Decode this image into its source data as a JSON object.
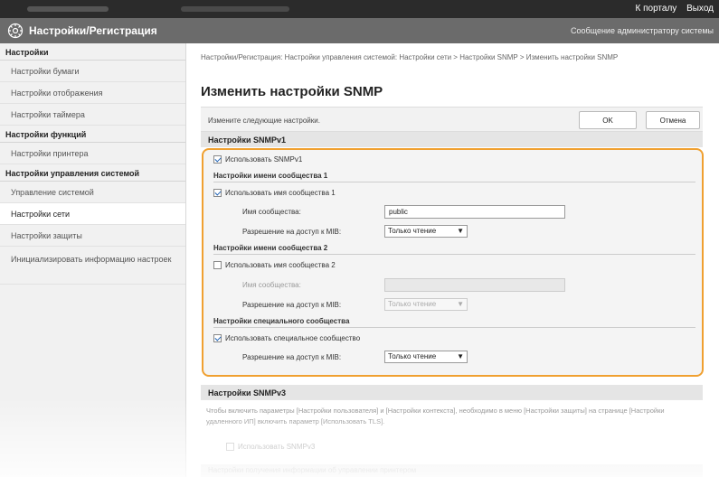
{
  "topbar": {
    "portal_link": "К порталу",
    "logout_link": "Выход"
  },
  "header": {
    "title": "Настройки/Регистрация",
    "admin_message": "Сообщение администратору системы"
  },
  "sidebar": {
    "sections": [
      {
        "title": "Настройки",
        "items": [
          "Настройки бумаги",
          "Настройки отображения",
          "Настройки таймера"
        ]
      },
      {
        "title": "Настройки функций",
        "items": [
          "Настройки принтера"
        ]
      },
      {
        "title": "Настройки управления системой",
        "items": [
          "Управление системой",
          "Настройки сети",
          "Настройки защиты",
          "Инициализировать информацию настроек"
        ]
      }
    ]
  },
  "main": {
    "breadcrumb": "Настройки/Регистрация: Настройки управления системой: Настройки сети > Настройки SNMP > Изменить настройки SNMP",
    "title": "Изменить настройки SNMP",
    "instruction": "Измените следующие настройки.",
    "ok_button": "OK",
    "cancel_button": "Отмена",
    "snmpv1": {
      "header": "Настройки SNMPv1",
      "use_label": "Использовать SNMPv1",
      "use_checked": true,
      "community1": {
        "header": "Настройки имени сообщества 1",
        "use_label": "Использовать имя сообщества 1",
        "use_checked": true,
        "name_label": "Имя сообщества:",
        "name_value": "public",
        "mib_label": "Разрешение на доступ к MIB:",
        "mib_value": "Только чтение"
      },
      "community2": {
        "header": "Настройки имени сообщества 2",
        "use_label": "Использовать имя сообщества 2",
        "use_checked": false,
        "name_label": "Имя сообщества:",
        "name_value": "",
        "mib_label": "Разрешение на доступ к MIB:",
        "mib_value": "Только чтение"
      },
      "dedicated": {
        "header": "Настройки специального сообщества",
        "use_label": "Использовать специальное сообщество",
        "use_checked": true,
        "mib_label": "Разрешение на доступ к MIB:",
        "mib_value": "Только чтение"
      }
    },
    "snmpv3": {
      "header": "Настройки SNMPv3",
      "note": "Чтобы включить параметры [Настройки пользователя] и [Настройки контекста], необходимо в меню [Настройки защиты] на странице [Настройки удаленного ИП] включить параметр [Использовать TLS].",
      "use_label": "Использовать SNMPv3",
      "use_checked": false
    },
    "next_section": "Настройки получения информации об управлении принтером"
  },
  "colors": {
    "highlight_border": "#f0a030",
    "title_bar": "#6b6b6b",
    "top_bar": "#2b2b2b"
  }
}
